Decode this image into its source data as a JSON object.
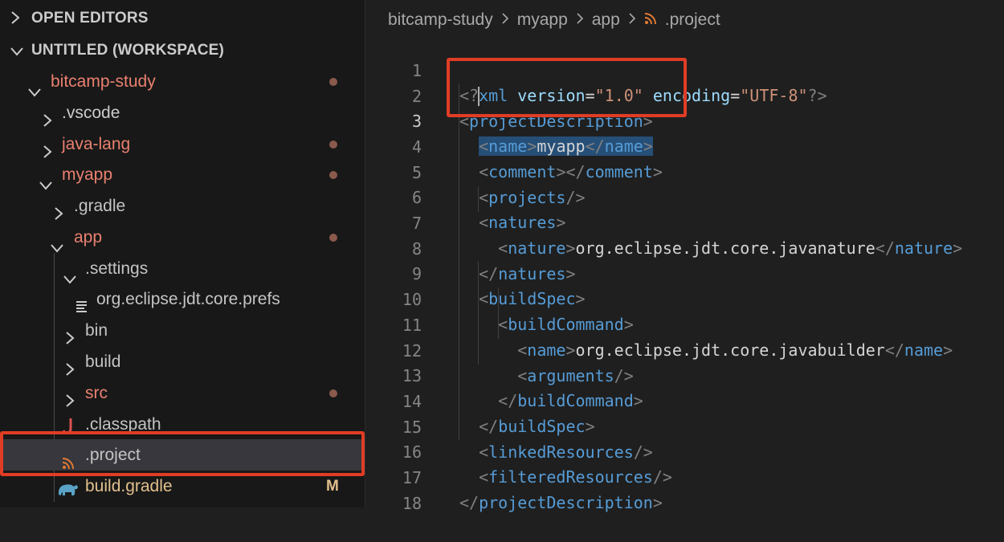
{
  "sidebar": {
    "open_editors": "OPEN EDITORS",
    "workspace": "UNTITLED (WORKSPACE)",
    "tree": [
      {
        "label": "bitcamp-study",
        "status": "modified-folder"
      },
      {
        "label": ".vscode",
        "status": "normal"
      },
      {
        "label": "java-lang",
        "status": "modified-folder"
      },
      {
        "label": "myapp",
        "status": "modified-folder"
      },
      {
        "label": ".gradle",
        "status": "normal"
      },
      {
        "label": "app",
        "status": "modified-folder"
      },
      {
        "label": ".settings",
        "status": "normal"
      },
      {
        "label": "org.eclipse.jdt.core.prefs",
        "status": "normal"
      },
      {
        "label": "bin",
        "status": "normal"
      },
      {
        "label": "build",
        "status": "normal"
      },
      {
        "label": "src",
        "status": "modified-folder"
      },
      {
        "label": ".classpath",
        "status": "normal"
      },
      {
        "label": ".project",
        "status": "selected"
      },
      {
        "label": "build.gradle",
        "status": "modified",
        "badge": "M"
      }
    ]
  },
  "breadcrumb": [
    "bitcamp-study",
    "myapp",
    "app",
    ".project"
  ],
  "editor": {
    "active_line": 3,
    "line_numbers": [
      "1",
      "2",
      "3",
      "4",
      "5",
      "6",
      "7",
      "8",
      "9",
      "10",
      "11",
      "12",
      "13",
      "14",
      "15",
      "16",
      "17",
      "18"
    ],
    "text": {
      "xml_decl_open": "<?",
      "xml": "xml",
      "version_attr": "version",
      "version_val": "\"1.0\"",
      "encoding_attr": "encoding",
      "encoding_val": "\"UTF-8\"",
      "xml_decl_close": "?>",
      "projectDescription": "projectDescription",
      "name": "name",
      "myapp": "myapp",
      "comment": "comment",
      "projects": "projects",
      "natures": "natures",
      "nature": "nature",
      "javanature": "org.eclipse.jdt.core.javanature",
      "buildSpec": "buildSpec",
      "buildCommand": "buildCommand",
      "javabuilder": "org.eclipse.jdt.core.javabuilder",
      "arguments": "arguments",
      "linkedResources": "linkedResources",
      "filteredResources": "filteredResources"
    }
  },
  "colors": {
    "highlight_box": "#e03d25",
    "tag": "#569cd6",
    "attribute": "#9cdcfe",
    "string": "#ce9178",
    "modified_folder": "#e9806f",
    "modified_file": "#e2c08d"
  }
}
